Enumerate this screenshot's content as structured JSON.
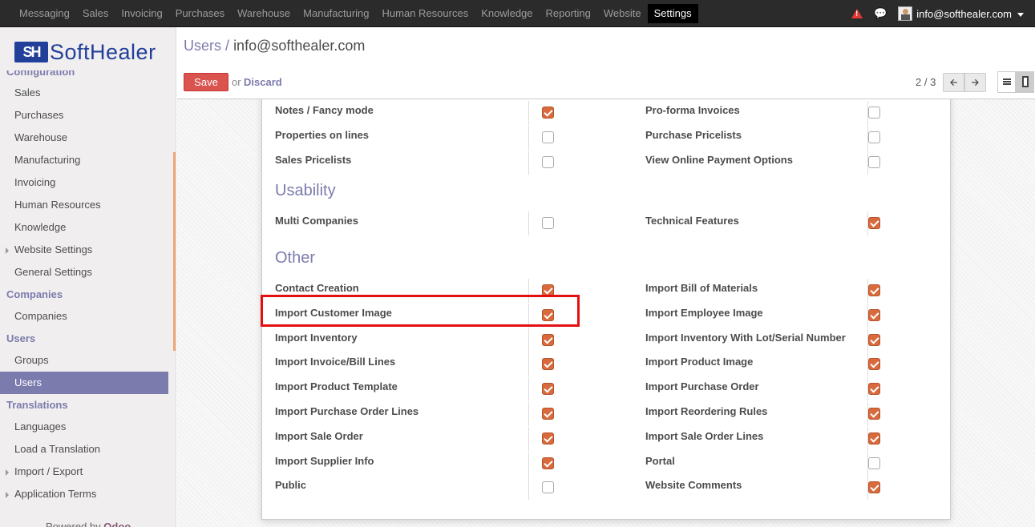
{
  "top_menu": [
    "Messaging",
    "Sales",
    "Invoicing",
    "Purchases",
    "Warehouse",
    "Manufacturing",
    "Human Resources",
    "Knowledge",
    "Reporting",
    "Website",
    "Settings"
  ],
  "top_menu_active": "Settings",
  "user": {
    "email": "info@softhealer.com"
  },
  "logo": {
    "mark": "SH",
    "text": "SoftHealer"
  },
  "sidebar": {
    "items": [
      {
        "kind": "section",
        "label": "Configuration",
        "cut": true
      },
      {
        "kind": "item",
        "label": "Sales"
      },
      {
        "kind": "item",
        "label": "Purchases"
      },
      {
        "kind": "item",
        "label": "Warehouse"
      },
      {
        "kind": "item",
        "label": "Manufacturing"
      },
      {
        "kind": "item",
        "label": "Invoicing"
      },
      {
        "kind": "item",
        "label": "Human Resources"
      },
      {
        "kind": "item",
        "label": "Knowledge"
      },
      {
        "kind": "item",
        "label": "Website Settings",
        "expand": true
      },
      {
        "kind": "item",
        "label": "General Settings"
      },
      {
        "kind": "section",
        "label": "Companies"
      },
      {
        "kind": "item",
        "label": "Companies"
      },
      {
        "kind": "section",
        "label": "Users"
      },
      {
        "kind": "item",
        "label": "Groups"
      },
      {
        "kind": "item",
        "label": "Users",
        "active": true
      },
      {
        "kind": "section",
        "label": "Translations"
      },
      {
        "kind": "item",
        "label": "Languages"
      },
      {
        "kind": "item",
        "label": "Load a Translation"
      },
      {
        "kind": "item",
        "label": "Import / Export",
        "expand": true
      },
      {
        "kind": "item",
        "label": "Application Terms",
        "expand": true
      }
    ],
    "powered_by": "Powered by",
    "powered_brand": "Odoo"
  },
  "breadcrumb": {
    "parent": "Users",
    "separator": "/",
    "current": "info@softhealer.com"
  },
  "buttons": {
    "save": "Save",
    "or": "or",
    "discard": "Discard"
  },
  "pager": {
    "text": "2 / 3"
  },
  "sections": [
    {
      "title": "",
      "rows": [
        {
          "left": "Notes / Fancy mode",
          "left_checked": true,
          "right": "Pro-forma Invoices",
          "right_checked": false
        },
        {
          "left": "Properties on lines",
          "left_checked": false,
          "right": "Purchase Pricelists",
          "right_checked": false
        },
        {
          "left": "Sales Pricelists",
          "left_checked": false,
          "right": "View Online Payment Options",
          "right_checked": false
        }
      ]
    },
    {
      "title": "Usability",
      "rows": [
        {
          "left": "Multi Companies",
          "left_checked": false,
          "right": "Technical Features",
          "right_checked": true
        }
      ]
    },
    {
      "title": "Other",
      "rows": [
        {
          "left": "Contact Creation",
          "left_checked": true,
          "right": "Import Bill of Materials",
          "right_checked": true
        },
        {
          "left": "Import Customer Image",
          "left_checked": true,
          "right": "Import Employee Image",
          "right_checked": true,
          "highlight": true
        },
        {
          "left": "Import Inventory",
          "left_checked": true,
          "right": "Import Inventory With Lot/Serial Number",
          "right_checked": true
        },
        {
          "left": "Import Invoice/Bill Lines",
          "left_checked": true,
          "right": "Import Product Image",
          "right_checked": true
        },
        {
          "left": "Import Product Template",
          "left_checked": true,
          "right": "Import Purchase Order",
          "right_checked": true
        },
        {
          "left": "Import Purchase Order Lines",
          "left_checked": true,
          "right": "Import Reordering Rules",
          "right_checked": true
        },
        {
          "left": "Import Sale Order",
          "left_checked": true,
          "right": "Import Sale Order Lines",
          "right_checked": true
        },
        {
          "left": "Import Supplier Info",
          "left_checked": true,
          "right": "Portal",
          "right_checked": false
        },
        {
          "left": "Public",
          "left_checked": false,
          "right": "Website Comments",
          "right_checked": true
        }
      ]
    }
  ],
  "colors": {
    "topbar": "#2b2b2b",
    "accent": "#7c7bad",
    "checkbox": "#d86a3d",
    "save": "#d9534f",
    "highlight": "#e31010"
  }
}
